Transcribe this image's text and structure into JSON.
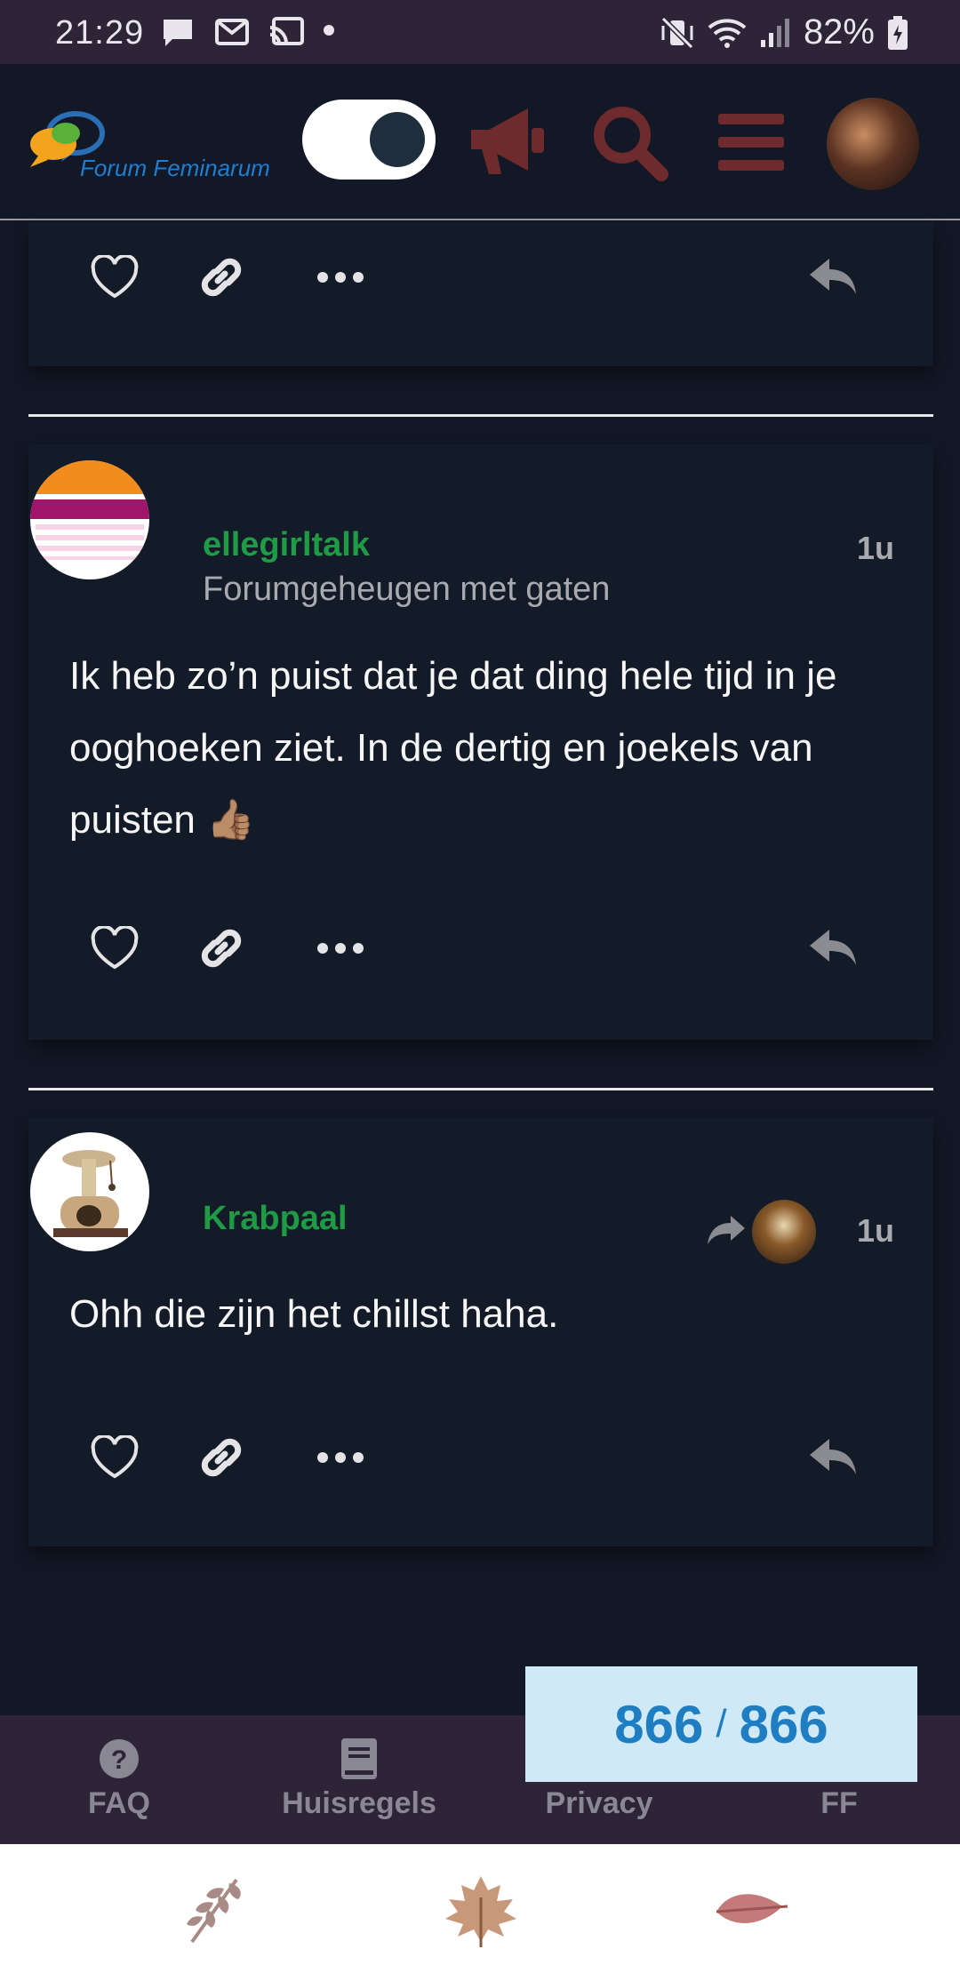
{
  "status_bar": {
    "time": "21:29",
    "battery": "82%"
  },
  "header": {
    "logo_text": "Forum Feminarum"
  },
  "posts": [
    {
      "username": "ellegirltalk",
      "user_title": "Forumgeheugen met gaten",
      "time": "1u",
      "body": "Ik heb zo’n puist dat je dat ding hele tijd in je ooghoeken ziet. In de dertig en joekels van puisten 👍🏽"
    },
    {
      "username": "Krabpaal",
      "user_title": "",
      "time": "1u",
      "body": "Ohh die zijn het chillst haha."
    }
  ],
  "progress": {
    "current": "866",
    "separator": "/",
    "total": "866"
  },
  "bottom_nav": {
    "items": [
      {
        "label": "FAQ",
        "icon": "question-circle-icon"
      },
      {
        "label": "Huisregels",
        "icon": "book-icon"
      },
      {
        "label": "Privacy",
        "icon": "shield-icon"
      },
      {
        "label": "FF",
        "icon": "ff-icon"
      }
    ]
  },
  "colors": {
    "background": "#121826",
    "status_bar": "#2d2437",
    "accent_icons": "#6e2a2c",
    "username_green": "#1f9a45",
    "progress_bg": "#cfe9f7",
    "progress_text": "#1f7ec1"
  }
}
